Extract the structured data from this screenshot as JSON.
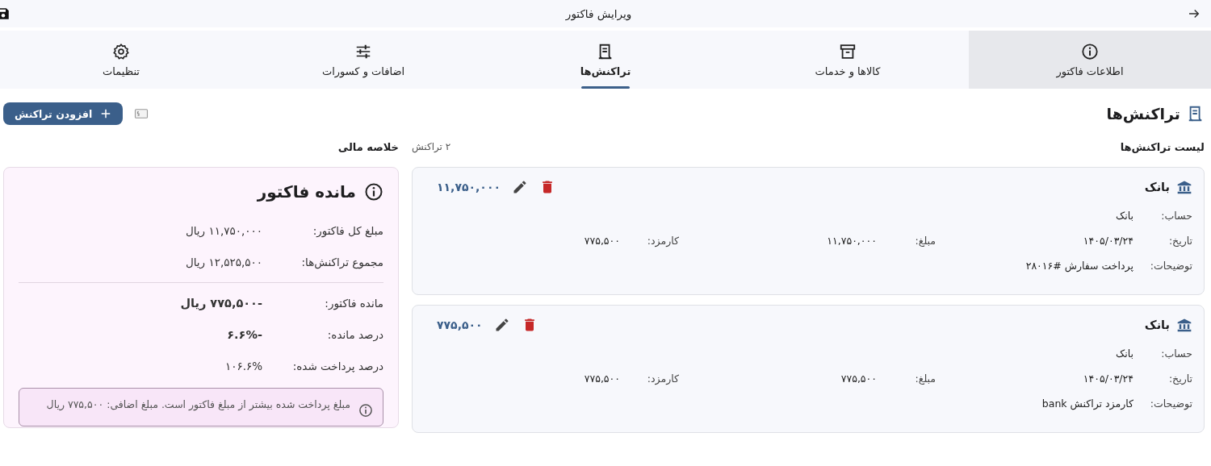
{
  "top_bar": {
    "title": "ویرایش فاکتور"
  },
  "tabs": [
    {
      "label": "اطلاعات فاکتور",
      "kind": "info",
      "selected": false,
      "highlighted": true
    },
    {
      "label": "کالاها و خدمات",
      "kind": "archive",
      "selected": false,
      "highlighted": false
    },
    {
      "label": "تراکنش‌ها",
      "kind": "receipt",
      "selected": true,
      "highlighted": false
    },
    {
      "label": "اضافات و کسورات",
      "kind": "sliders",
      "selected": false,
      "highlighted": false
    },
    {
      "label": "تنظیمات",
      "kind": "settings",
      "selected": false,
      "highlighted": false
    }
  ],
  "section": {
    "title": "تراکنش‌ها",
    "add_button": "افزودن تراکنش"
  },
  "transactions": {
    "heading": "لیست تراکنش‌ها",
    "count": "۲ تراکنش",
    "items": [
      {
        "name": "بانک",
        "kind": "bank",
        "amount": "۱۱,۷۵۰,۰۰۰",
        "fields": [
          [
            {
              "label": "حساب:",
              "value": "بانک"
            }
          ],
          [
            {
              "label": "تاریخ:",
              "value": "۱۴۰۵/۰۳/۲۴"
            },
            {
              "label": "مبلغ:",
              "value": "۱۱,۷۵۰,۰۰۰"
            },
            {
              "label": "کارمزد:",
              "value": "۷۷۵,۵۰۰"
            }
          ],
          [
            {
              "label": "توضیحات:",
              "value": "پرداخت سفارش #۲۸۰۱۶"
            }
          ]
        ]
      },
      {
        "name": "بانک",
        "kind": "bank",
        "amount": "۷۷۵,۵۰۰",
        "fields": [
          [
            {
              "label": "حساب:",
              "value": "بانک"
            }
          ],
          [
            {
              "label": "تاریخ:",
              "value": "۱۴۰۵/۰۳/۲۴"
            },
            {
              "label": "مبلغ:",
              "value": "۷۷۵,۵۰۰"
            },
            {
              "label": "کارمزد:",
              "value": "۷۷۵,۵۰۰"
            }
          ],
          [
            {
              "label": "توضیحات:",
              "value": "کارمزد تراکنش bank"
            }
          ]
        ]
      }
    ]
  },
  "summary": {
    "heading": "خلاصه مالی",
    "title": "مانده فاکتور",
    "groups": [
      [
        {
          "label": "مبلغ کل فاکتور:",
          "value": "۱۱,۷۵۰,۰۰۰ ریال",
          "emphasized": false
        },
        {
          "label": "مجموع تراکنش‌ها:",
          "value": "۱۲,۵۲۵,۵۰۰ ریال",
          "emphasized": false
        }
      ],
      [
        {
          "label": "مانده فاکتور:",
          "value": "-۷۷۵,۵۰۰ ریال",
          "emphasized": true
        },
        {
          "label": "درصد مانده:",
          "value": "-۶.۶%",
          "emphasized": true
        },
        {
          "label": "درصد پرداخت شده:",
          "value": "۱۰۶.۶%",
          "emphasized": false
        }
      ]
    ],
    "alert": "مبلغ پرداخت شده بیشتر از مبلغ فاکتور است. مبلغ اضافی: ۷۷۵,۵۰۰ ریال"
  }
}
